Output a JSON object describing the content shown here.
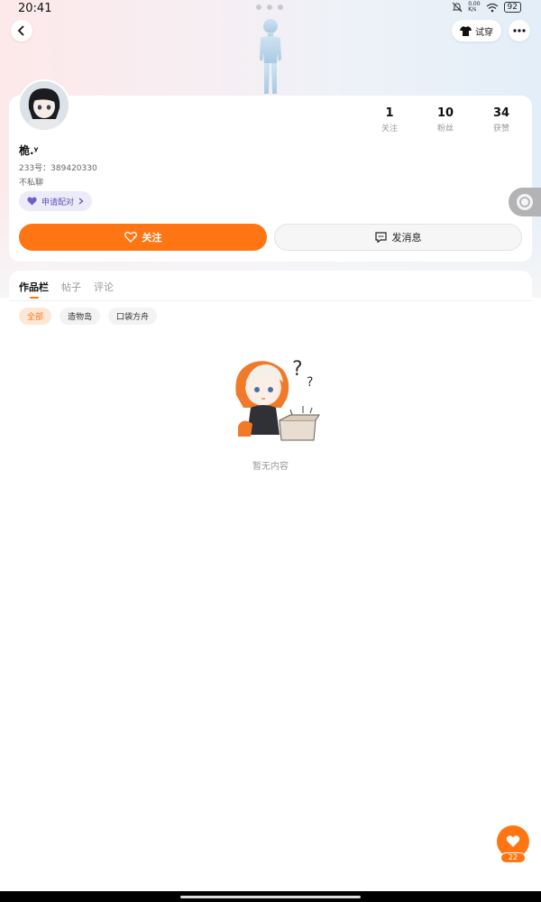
{
  "status_bar": {
    "time": "20:41",
    "speed": "0.00\nK/s",
    "battery": "92"
  },
  "header": {
    "try_on_label": "试穿"
  },
  "profile": {
    "username": "桅.ʸ",
    "uid": "233号：389420330",
    "bio": "不私聊",
    "cp_label": "申请配对",
    "stats": [
      {
        "value": "1",
        "label": "关注"
      },
      {
        "value": "10",
        "label": "粉丝"
      },
      {
        "value": "34",
        "label": "获赞"
      }
    ]
  },
  "actions": {
    "follow_label": "关注",
    "message_label": "发消息"
  },
  "tabs": [
    {
      "label": "作品栏",
      "active": true
    },
    {
      "label": "帖子",
      "active": false
    },
    {
      "label": "评论",
      "active": false
    }
  ],
  "filters": [
    {
      "label": "全部",
      "active": true
    },
    {
      "label": "造物岛",
      "active": false
    },
    {
      "label": "口袋方舟",
      "active": false
    }
  ],
  "empty_state": {
    "text": "暂无内容"
  },
  "like_count": "22",
  "colors": {
    "accent": "#ff7514",
    "cp": "#5b52b9"
  },
  "icons": [
    "back-icon",
    "tshirt-icon",
    "more-icon",
    "heart-icon",
    "chat-icon",
    "heart-add-icon",
    "float-ball-icon"
  ]
}
